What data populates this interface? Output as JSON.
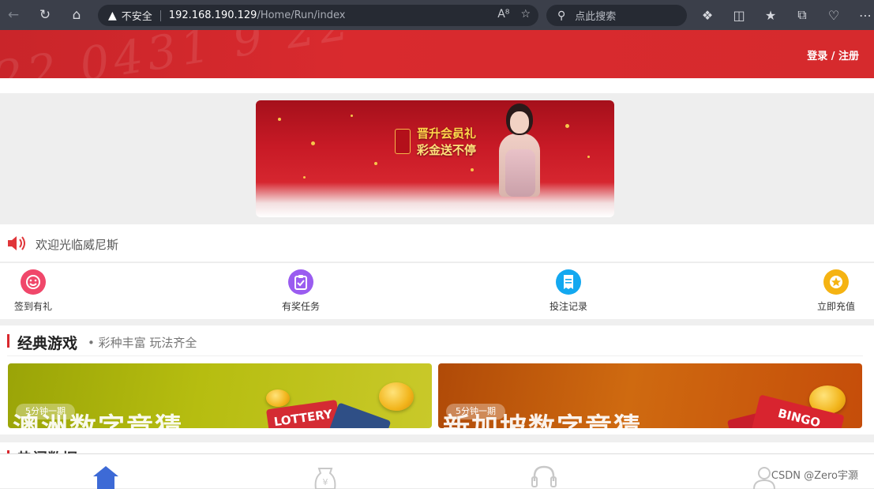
{
  "browser": {
    "insecure_label": "不安全",
    "url_host": "192.168.190.129",
    "url_path": "/Home/Run/index",
    "search_placeholder": "点此搜索"
  },
  "header": {
    "login_register": "登录 / 注册"
  },
  "banner": {
    "line1": "晋升会员礼",
    "line2": "彩金送不停"
  },
  "notice": {
    "text": "欢迎光临威尼斯"
  },
  "quick_actions": [
    {
      "label": "签到有礼",
      "icon": "smile-icon",
      "color": "#f0476a"
    },
    {
      "label": "有奖任务",
      "icon": "clipboard-check-icon",
      "color": "#9a5cf0"
    },
    {
      "label": "投注记录",
      "icon": "receipt-icon",
      "color": "#13a8f0"
    },
    {
      "label": "立即充值",
      "icon": "star-icon",
      "color": "#f5b312"
    }
  ],
  "classic_games": {
    "title": "经典游戏",
    "subtitle": "• 彩种丰富 玩法齐全",
    "cards": [
      {
        "tag": "5分钟一期",
        "title": "澳洲数字竞猜",
        "ticket_text": "LOTTERY"
      },
      {
        "tag": "5分钟一期",
        "title": "新加坡数字竞猜",
        "ticket_text": "BINGO"
      }
    ]
  },
  "hot_section": {
    "title": "热门数据"
  },
  "bottom_nav": [
    {
      "icon": "home-icon",
      "active": true
    },
    {
      "icon": "money-bag-icon",
      "active": false
    },
    {
      "icon": "headset-icon",
      "active": false
    },
    {
      "icon": "user-icon",
      "active": false
    }
  ],
  "watermark": "CSDN @Zero宇灏",
  "colors": {
    "brand_red": "#d62a2d",
    "active_nav": "#3d6ad6"
  }
}
